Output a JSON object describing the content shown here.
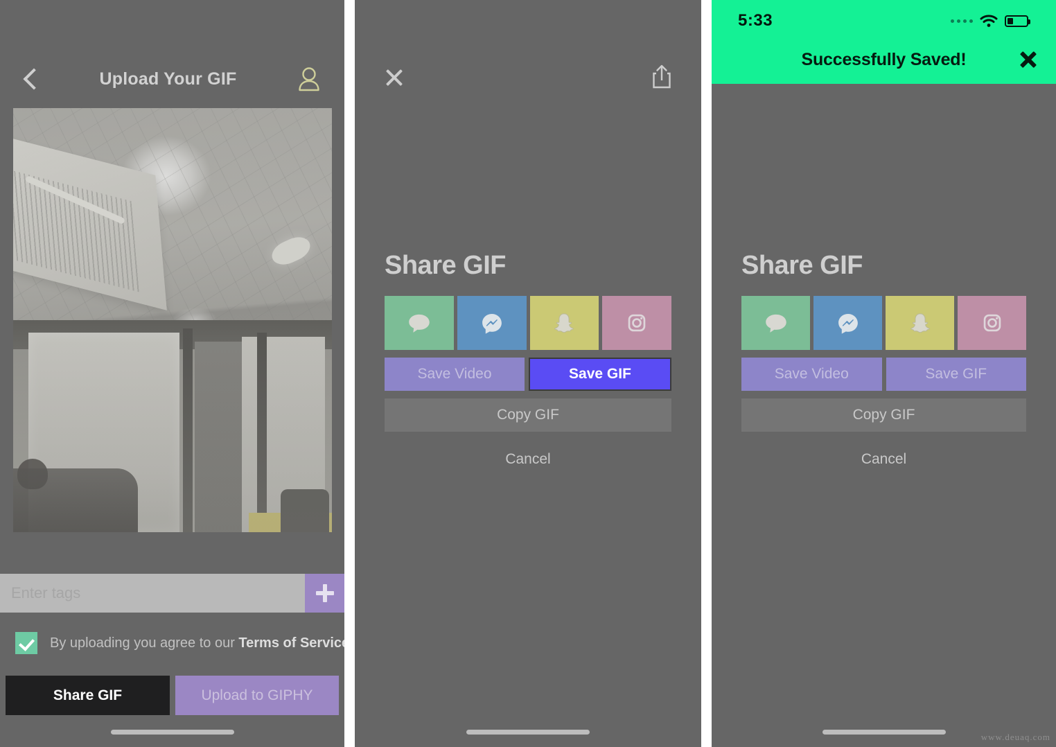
{
  "colors": {
    "background_gray": "#666666",
    "accent_purple": "#9b87c4",
    "active_blue": "#5a4cf4",
    "success_green": "#14f195",
    "checkbox_green": "#6ecba4",
    "dark_button": "#1f1f20"
  },
  "panel_upload": {
    "nav": {
      "back_icon": "chevron-left-icon",
      "title": "Upload Your GIF",
      "profile_icon": "user-account-icon"
    },
    "preview": {
      "alt": "GIF preview of office ceiling with air conditioner vent and glass partition walls"
    },
    "tags": {
      "placeholder": "Enter tags",
      "value": "",
      "add_label": "+"
    },
    "terms": {
      "checked": true,
      "text_prefix": "By uploading you agree to our ",
      "link_label": "Terms of Service"
    },
    "buttons": {
      "share": "Share GIF",
      "upload": "Upload to GIPHY"
    }
  },
  "panel_share": {
    "nav": {
      "close_icon": "close-x-icon",
      "share_icon": "share-export-icon"
    },
    "title": "Share GIF",
    "apps": [
      {
        "name": "messages",
        "icon": "speech-bubble-icon",
        "color": "#7cbd96"
      },
      {
        "name": "messenger",
        "icon": "messenger-bolt-icon",
        "color": "#5e92c0"
      },
      {
        "name": "snapchat",
        "icon": "snapchat-ghost-icon",
        "color": "#cbc974"
      },
      {
        "name": "instagram",
        "icon": "instagram-camera-icon",
        "color": "#be8fa6"
      }
    ],
    "actions": {
      "save_video": "Save Video",
      "save_gif": "Save GIF",
      "copy_gif": "Copy GIF",
      "cancel": "Cancel"
    },
    "save_gif_highlighted": true
  },
  "panel_saved": {
    "status_bar": {
      "time": "5:33",
      "signal_icon": "signal-dots-icon",
      "wifi_icon": "wifi-icon",
      "battery_icon": "battery-low-icon"
    },
    "toast": {
      "message": "Successfully Saved!",
      "close_icon": "close-x-icon"
    },
    "title": "Share GIF",
    "apps": [
      {
        "name": "messages",
        "icon": "speech-bubble-icon",
        "color": "#7cbd96"
      },
      {
        "name": "messenger",
        "icon": "messenger-bolt-icon",
        "color": "#5e92c0"
      },
      {
        "name": "snapchat",
        "icon": "snapchat-ghost-icon",
        "color": "#cbc974"
      },
      {
        "name": "instagram",
        "icon": "instagram-camera-icon",
        "color": "#be8fa6"
      }
    ],
    "actions": {
      "save_video": "Save Video",
      "save_gif": "Save GIF",
      "copy_gif": "Copy GIF",
      "cancel": "Cancel"
    },
    "save_gif_highlighted": false
  },
  "watermark": "www.deuaq.com"
}
